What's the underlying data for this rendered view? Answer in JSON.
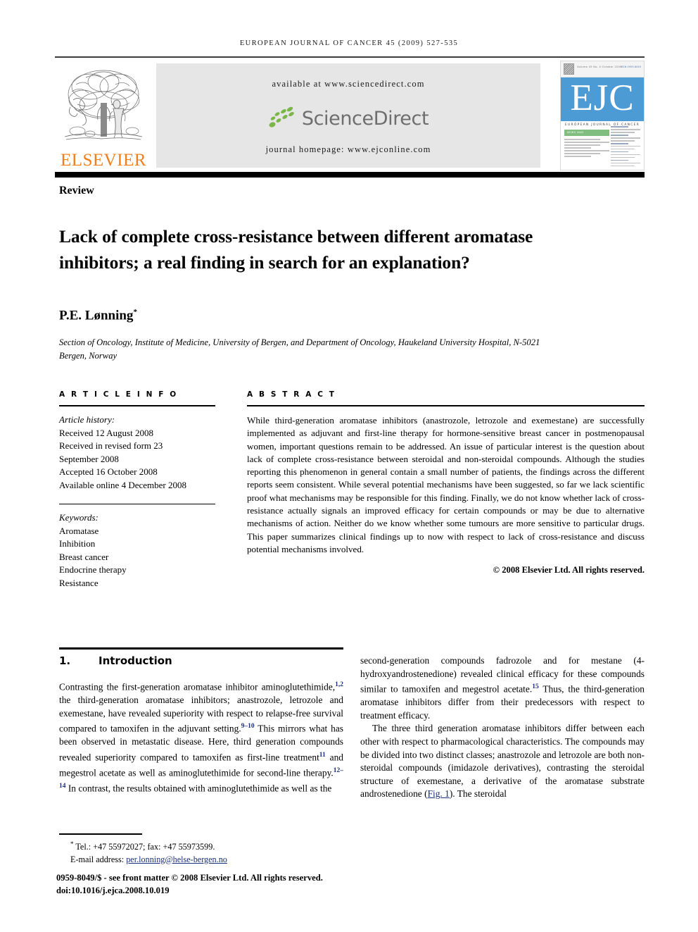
{
  "running_head": "EUROPEAN JOURNAL OF CANCER 45 (2009) 527-535",
  "header": {
    "elsevier_wordmark": "ELSEVIER",
    "available_at": "available at www.sciencedirect.com",
    "sciencedirect_wordmark": "ScienceDirect",
    "journal_homepage": "journal homepage: www.ejconline.com",
    "cover": {
      "letters": "EJC",
      "journal_name": "EUROPEAN JOURNAL OF CANCER",
      "band_label": "NEWS AND",
      "top_note": "Volume 45 No. 4 October 2009",
      "issn": "ISSN 0959-8049"
    },
    "colors": {
      "elsevier_orange": "#F07F1A",
      "sciencedirect_green": "#7AB648",
      "sciencedirect_grey": "#6E6E6E",
      "panel_grey": "#E6E6E6",
      "ejc_blue": "#4C9BD4",
      "ejc_green": "#7FBE7F",
      "link_blue": "#1A2F7A"
    }
  },
  "article": {
    "type_label": "Review",
    "title": "Lack of complete cross-resistance between different aromatase inhibitors; a real finding in search for an explanation?",
    "author": "P.E. Lønning",
    "author_marker": "*",
    "affiliation": "Section of Oncology, Institute of Medicine, University of Bergen, and Department of Oncology, Haukeland University Hospital, N-5021 Bergen, Norway"
  },
  "article_info": {
    "heading": "A R T I C L E   I N F O",
    "history_label": "Article history:",
    "history": [
      "Received 12 August 2008",
      "Received in revised form 23",
      "September 2008",
      "Accepted 16 October 2008",
      "Available online 4 December 2008"
    ],
    "keywords_label": "Keywords:",
    "keywords": [
      "Aromatase",
      "Inhibition",
      "Breast cancer",
      "Endocrine therapy",
      "Resistance"
    ]
  },
  "abstract": {
    "heading": "A B S T R A C T",
    "text": "While third-generation aromatase inhibitors (anastrozole, letrozole and exemestane) are successfully implemented as adjuvant and first-line therapy for hormone-sensitive breast cancer in postmenopausal women, important questions remain to be addressed. An issue of particular interest is the question about lack of complete cross-resistance between steroidal and non-steroidal compounds. Although the studies reporting this phenomenon in general contain a small number of patients, the findings across the different reports seem consistent. While several potential mechanisms have been suggested, so far we lack scientific proof what mechanisms may be responsible for this finding. Finally, we do not know whether lack of cross-resistance actually signals an improved efficacy for certain compounds or may be due to alternative mechanisms of action. Neither do we know whether some tumours are more sensitive to particular drugs. This paper summarizes clinical findings up to now with respect to lack of cross-resistance and discuss potential mechanisms involved.",
    "copyright": "© 2008 Elsevier Ltd. All rights reserved."
  },
  "section": {
    "number": "1.",
    "title": "Introduction"
  },
  "body": {
    "left_para_1_a": "Contrasting the first-generation aromatase inhibitor aminoglutethimide,",
    "left_ref_1": "1,2",
    "left_para_1_b": " the third-generation aromatase inhibitors; anastrozole, letrozole and exemestane, have revealed superiority with respect to relapse-free survival compared to tamoxifen in the adjuvant setting.",
    "left_ref_2": "9–10",
    "left_para_1_c": " This mirrors what has been observed in metastatic disease. Here, third generation compounds revealed superiority compared to tamoxifen as first-line treatment",
    "left_ref_3": "11",
    "left_para_1_d": " and megestrol acetate as well as aminoglutethimide for second-line therapy.",
    "left_ref_4": "12–14",
    "left_para_1_e": " In contrast, the results obtained with aminoglutethimide as well as the",
    "right_para_1_a": "second-generation compounds fadrozole and for mestane (4-hydroxyandrostenedione) revealed clinical efficacy for these compounds similar to tamoxifen and megestrol acetate.",
    "right_ref_1": "15",
    "right_para_1_b": " Thus, the third-generation aromatase inhibitors differ from their predecessors with respect to treatment efficacy.",
    "right_para_2_a": "The three third generation aromatase inhibitors differ between each other with respect to pharmacological characteristics. The compounds may be divided into two distinct classes; anastrozole and letrozole are both non-steroidal compounds (imidazole derivatives), contrasting the steroidal structure of exemestane, a derivative of the aromatase substrate androstenedione (",
    "right_xref": "Fig. 1",
    "right_para_2_b": "). The steroidal"
  },
  "footnote": {
    "tel_line": "Tel.: +47 55972027; fax: +47 55973599.",
    "email_label": "E-mail address:",
    "email": "per.lonning@helse-bergen.no",
    "front_matter": "0959-8049/$ - see front matter © 2008 Elsevier Ltd. All rights reserved.",
    "doi": "doi:10.1016/j.ejca.2008.10.019"
  }
}
